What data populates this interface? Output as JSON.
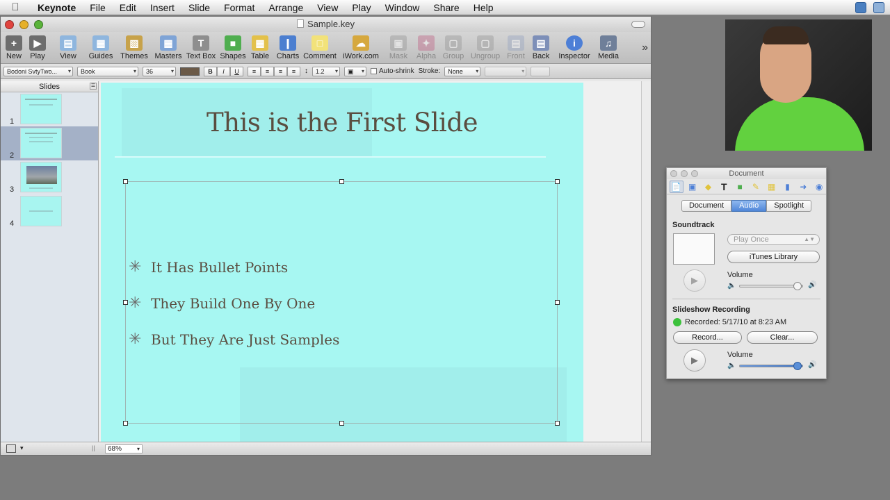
{
  "menubar": {
    "app": "Keynote",
    "items": [
      "File",
      "Edit",
      "Insert",
      "Slide",
      "Format",
      "Arrange",
      "View",
      "Play",
      "Window",
      "Share",
      "Help"
    ]
  },
  "window": {
    "title": "Sample.key"
  },
  "toolbar": {
    "items": [
      {
        "label": "New",
        "icon": "plus-icon",
        "color": "#6d6d6d"
      },
      {
        "label": "Play",
        "icon": "play-icon",
        "color": "#6d6d6d"
      },
      {
        "label": "View",
        "icon": "view-icon",
        "color": "#8fb6de"
      },
      {
        "label": "Guides",
        "icon": "guides-icon",
        "color": "#8fb6de"
      },
      {
        "label": "Themes",
        "icon": "themes-icon",
        "color": "#c7a24a"
      },
      {
        "label": "Masters",
        "icon": "masters-icon",
        "color": "#7fa4d6"
      },
      {
        "label": "Text Box",
        "icon": "textbox-icon",
        "color": "#8e8e8e"
      },
      {
        "label": "Shapes",
        "icon": "shapes-icon",
        "color": "#4fae4f"
      },
      {
        "label": "Table",
        "icon": "table-icon",
        "color": "#e3c14a"
      },
      {
        "label": "Charts",
        "icon": "charts-icon",
        "color": "#4c7fd0"
      },
      {
        "label": "Comment",
        "icon": "comment-icon",
        "color": "#f2e27a"
      },
      {
        "label": "iWork.com",
        "icon": "iwork-icon",
        "color": "#d6a83e"
      },
      {
        "label": "Mask",
        "icon": "mask-icon",
        "color": "#9a9a9a",
        "disabled": true
      },
      {
        "label": "Alpha",
        "icon": "alpha-icon",
        "color": "#c06a8a",
        "disabled": true
      },
      {
        "label": "Group",
        "icon": "group-icon",
        "color": "#9a9a9a",
        "disabled": true
      },
      {
        "label": "Ungroup",
        "icon": "ungroup-icon",
        "color": "#9a9a9a",
        "disabled": true
      },
      {
        "label": "Front",
        "icon": "front-icon",
        "color": "#9aa7c2",
        "disabled": true
      },
      {
        "label": "Back",
        "icon": "back-icon",
        "color": "#7d8fb8"
      },
      {
        "label": "Inspector",
        "icon": "info-icon",
        "color": "#4d7fd6"
      },
      {
        "label": "Media",
        "icon": "media-icon",
        "color": "#6f7f99"
      }
    ]
  },
  "formatbar": {
    "font": "Bodoni SvtyTwo...",
    "style": "Book",
    "size": "36",
    "line_spacing": "1.2",
    "autoshrink": "Auto-shrink",
    "stroke_label": "Stroke:",
    "stroke_value": "None"
  },
  "slides_panel": {
    "header": "Slides",
    "thumbs": [
      {
        "num": "1"
      },
      {
        "num": "2"
      },
      {
        "num": "3"
      },
      {
        "num": "4"
      }
    ]
  },
  "slide": {
    "title": "This is the First Slide",
    "bullets": [
      "It Has Bullet Points",
      "They Build One By One",
      "But They Are Just Samples"
    ]
  },
  "bottombar": {
    "zoom": "68%"
  },
  "inspector": {
    "title": "Document",
    "tabs": [
      "Document",
      "Audio",
      "Spotlight"
    ],
    "soundtrack_label": "Soundtrack",
    "play_mode": "Play Once",
    "itunes_button": "iTunes Library",
    "volume_label": "Volume",
    "recording_label": "Slideshow Recording",
    "recorded_text": "Recorded: 5/17/10 at 8:23 AM",
    "record_button": "Record...",
    "clear_button": "Clear...",
    "soundtrack_volume": 0.92,
    "recording_volume": 0.92
  }
}
